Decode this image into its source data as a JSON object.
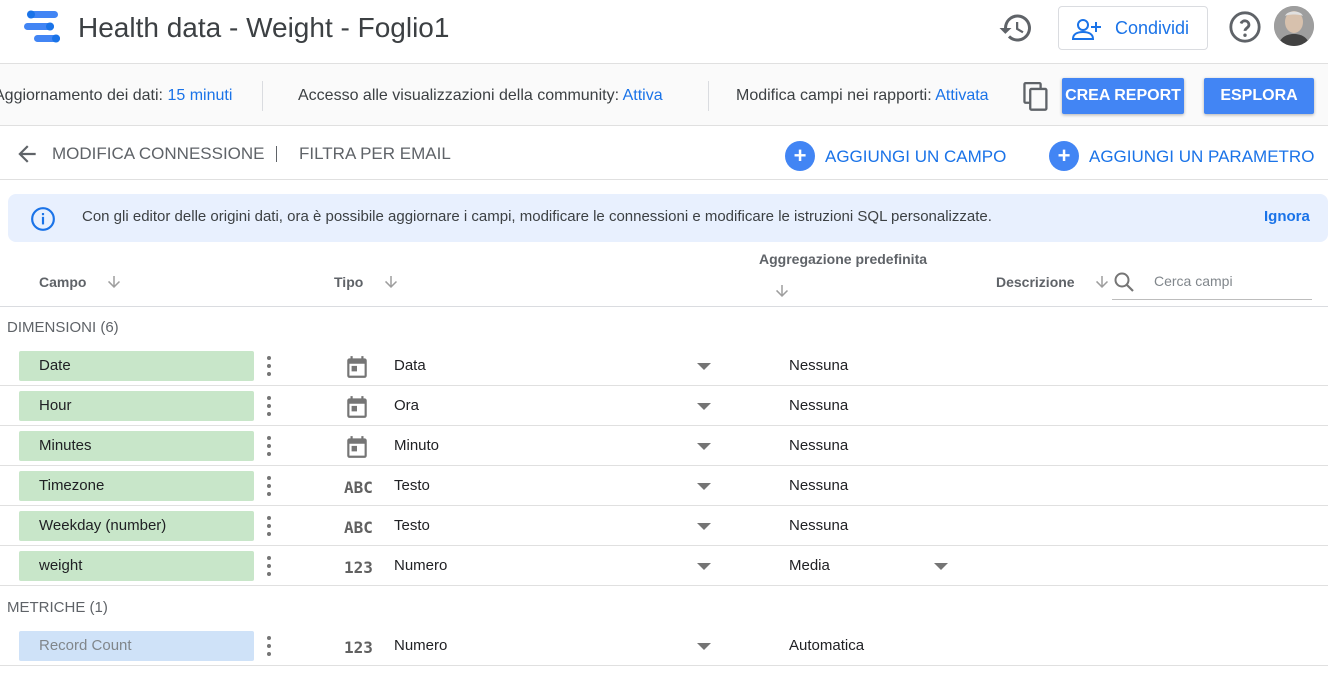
{
  "header": {
    "title": "Health data - Weight - Foglio1",
    "share_label": "Condividi"
  },
  "settings": {
    "refresh_label": "Aggiornamento dei dati:",
    "refresh_value": "15 minuti",
    "community_label": "Accesso alle visualizzazioni della community:",
    "community_value": "Attiva",
    "edit_fields_label": "Modifica campi nei rapporti:",
    "edit_fields_value": "Attivata",
    "create_report": "CREA REPORT",
    "explore": "ESPLORA"
  },
  "actionbar": {
    "edit_connection": "MODIFICA CONNESSIONE",
    "filter_email": "FILTRA PER EMAIL",
    "add_field": "AGGIUNGI UN CAMPO",
    "add_parameter": "AGGIUNGI UN PARAMETRO"
  },
  "banner": {
    "text": "Con gli editor delle origini dati, ora è possibile aggiornare i campi, modificare le connessioni e modificare le istruzioni SQL personalizzate.",
    "dismiss": "Ignora"
  },
  "columns": {
    "field": "Campo",
    "type": "Tipo",
    "aggregation": "Aggregazione predefinita",
    "description": "Descrizione",
    "search_placeholder": "Cerca campi"
  },
  "dimensions": {
    "title": "DIMENSIONI (6)",
    "rows": [
      {
        "name": "Date",
        "type_icon": "calendar-icon",
        "type": "Data",
        "aggregation": "Nessuna"
      },
      {
        "name": "Hour",
        "type_icon": "calendar-icon",
        "type": "Ora",
        "aggregation": "Nessuna"
      },
      {
        "name": "Minutes",
        "type_icon": "calendar-icon",
        "type": "Minuto",
        "aggregation": "Nessuna"
      },
      {
        "name": "Timezone",
        "type_icon": "text-type-icon",
        "type_glyph": "ABC",
        "type": "Testo",
        "aggregation": "Nessuna"
      },
      {
        "name": "Weekday (number)",
        "type_icon": "text-type-icon",
        "type_glyph": "ABC",
        "type": "Testo",
        "aggregation": "Nessuna"
      },
      {
        "name": "weight",
        "type_icon": "number-type-icon",
        "type_glyph": "123",
        "type": "Numero",
        "aggregation": "Media"
      }
    ]
  },
  "metrics": {
    "title": "METRICHE (1)",
    "rows": [
      {
        "name": "Record Count",
        "type_icon": "number-type-icon",
        "type_glyph": "123",
        "type": "Numero",
        "aggregation": "Automatica"
      }
    ]
  },
  "colors": {
    "accent": "#1a73e8",
    "button_blue": "#4285f4",
    "dimension_chip": "#c8e6c9",
    "metric_chip": "#cfe2f8",
    "banner_bg": "#e8f0fe"
  }
}
